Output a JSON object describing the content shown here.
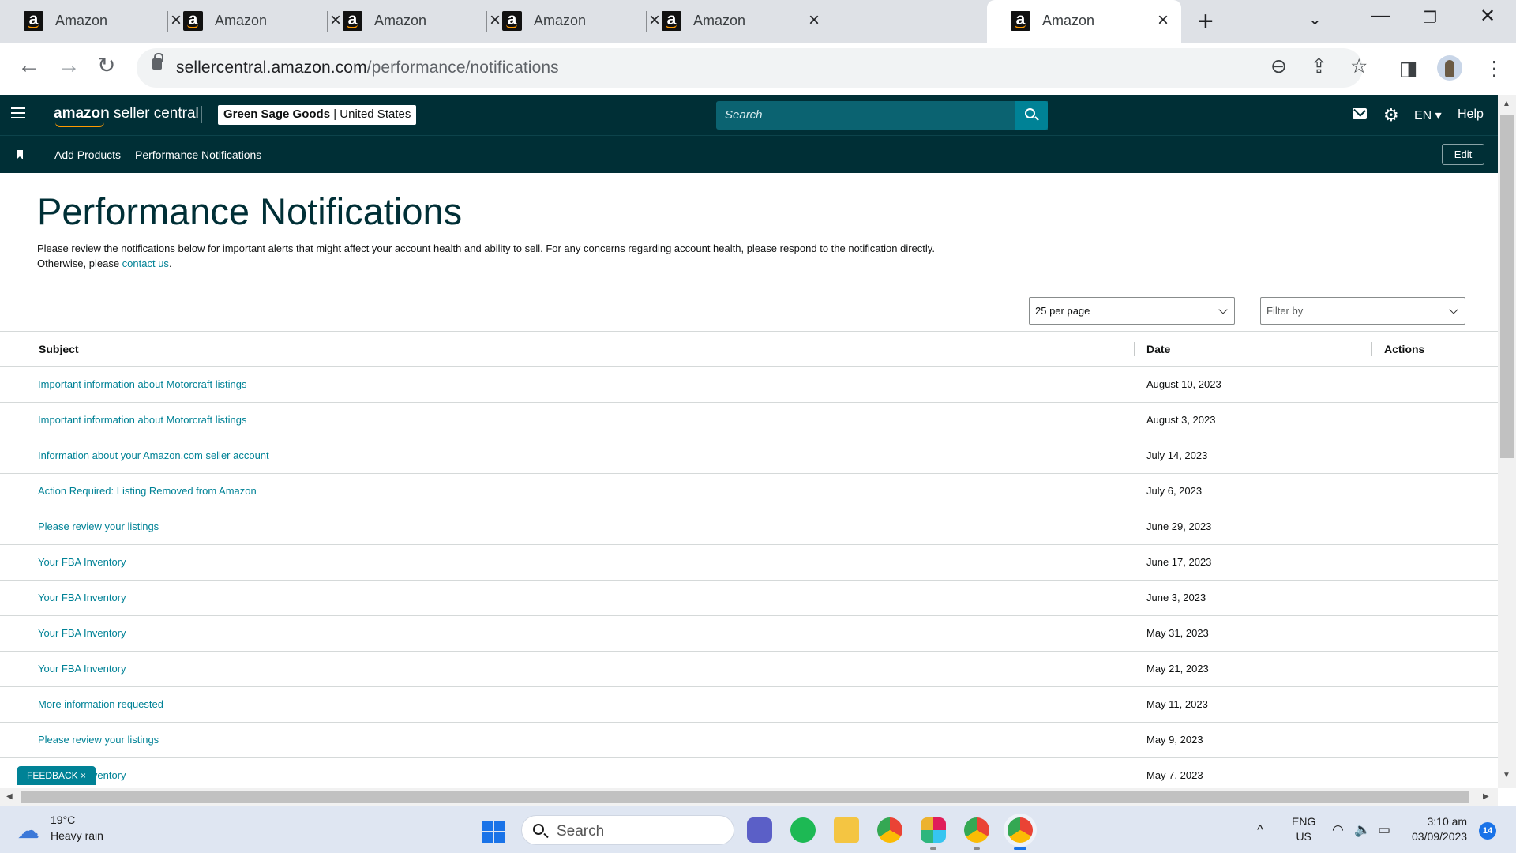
{
  "browser": {
    "tabs": [
      {
        "title": "Amazon",
        "active": false
      },
      {
        "title": "Amazon",
        "active": false
      },
      {
        "title": "Amazon",
        "active": false
      },
      {
        "title": "Amazon",
        "active": false
      },
      {
        "title": "Amazon",
        "active": false
      },
      {
        "title": "Amazon",
        "active": true
      }
    ],
    "url_host": "sellercentral.amazon.com",
    "url_path": "/performance/notifications"
  },
  "header": {
    "logo_bold": "amazon",
    "logo_rest": " seller central",
    "store_name": "Green Sage Goods",
    "store_sep": " | ",
    "marketplace": "United States",
    "search_placeholder": "Search",
    "language": "EN ▾",
    "help": "Help"
  },
  "subnav": {
    "links": [
      "Add Products",
      "Performance Notifications"
    ],
    "edit": "Edit"
  },
  "page": {
    "title": "Performance Notifications",
    "intro_line1": "Please review the notifications below for important alerts that might affect your account health and ability to sell. For any concerns regarding account health, please respond to the notification directly.",
    "intro_line2_prefix": "Otherwise, please ",
    "contact_link": "contact us",
    "intro_line2_suffix": ".",
    "per_page": "25 per page",
    "filter_placeholder": "Filter by"
  },
  "table": {
    "headers": {
      "subject": "Subject",
      "date": "Date",
      "actions": "Actions"
    },
    "rows": [
      {
        "subject": "Important information about Motorcraft listings",
        "date": "August 10, 2023"
      },
      {
        "subject": "Important information about Motorcraft listings",
        "date": "August 3, 2023"
      },
      {
        "subject": "Information about your Amazon.com seller account",
        "date": "July 14, 2023"
      },
      {
        "subject": "Action Required: Listing Removed from Amazon",
        "date": "July 6, 2023"
      },
      {
        "subject": "Please review your listings",
        "date": "June 29, 2023"
      },
      {
        "subject": "Your FBA Inventory",
        "date": "June 17, 2023"
      },
      {
        "subject": "Your FBA Inventory",
        "date": "June 3, 2023"
      },
      {
        "subject": "Your FBA Inventory",
        "date": "May 31, 2023"
      },
      {
        "subject": "Your FBA Inventory",
        "date": "May 21, 2023"
      },
      {
        "subject": "More information requested",
        "date": "May 11, 2023"
      },
      {
        "subject": "Please review your listings",
        "date": "May 9, 2023"
      },
      {
        "subject": "Your FBA Inventory",
        "date": "May 7, 2023"
      }
    ]
  },
  "feedback": "FEEDBACK ×",
  "taskbar": {
    "temperature": "19°C",
    "weather": "Heavy rain",
    "search": "Search",
    "lang_line1": "ENG",
    "lang_line2": "US",
    "time": "3:10 am",
    "date": "03/09/2023",
    "notifications": "14"
  },
  "colors": {
    "header_bg": "#002f36",
    "link": "#008296",
    "search_button": "#008296"
  }
}
